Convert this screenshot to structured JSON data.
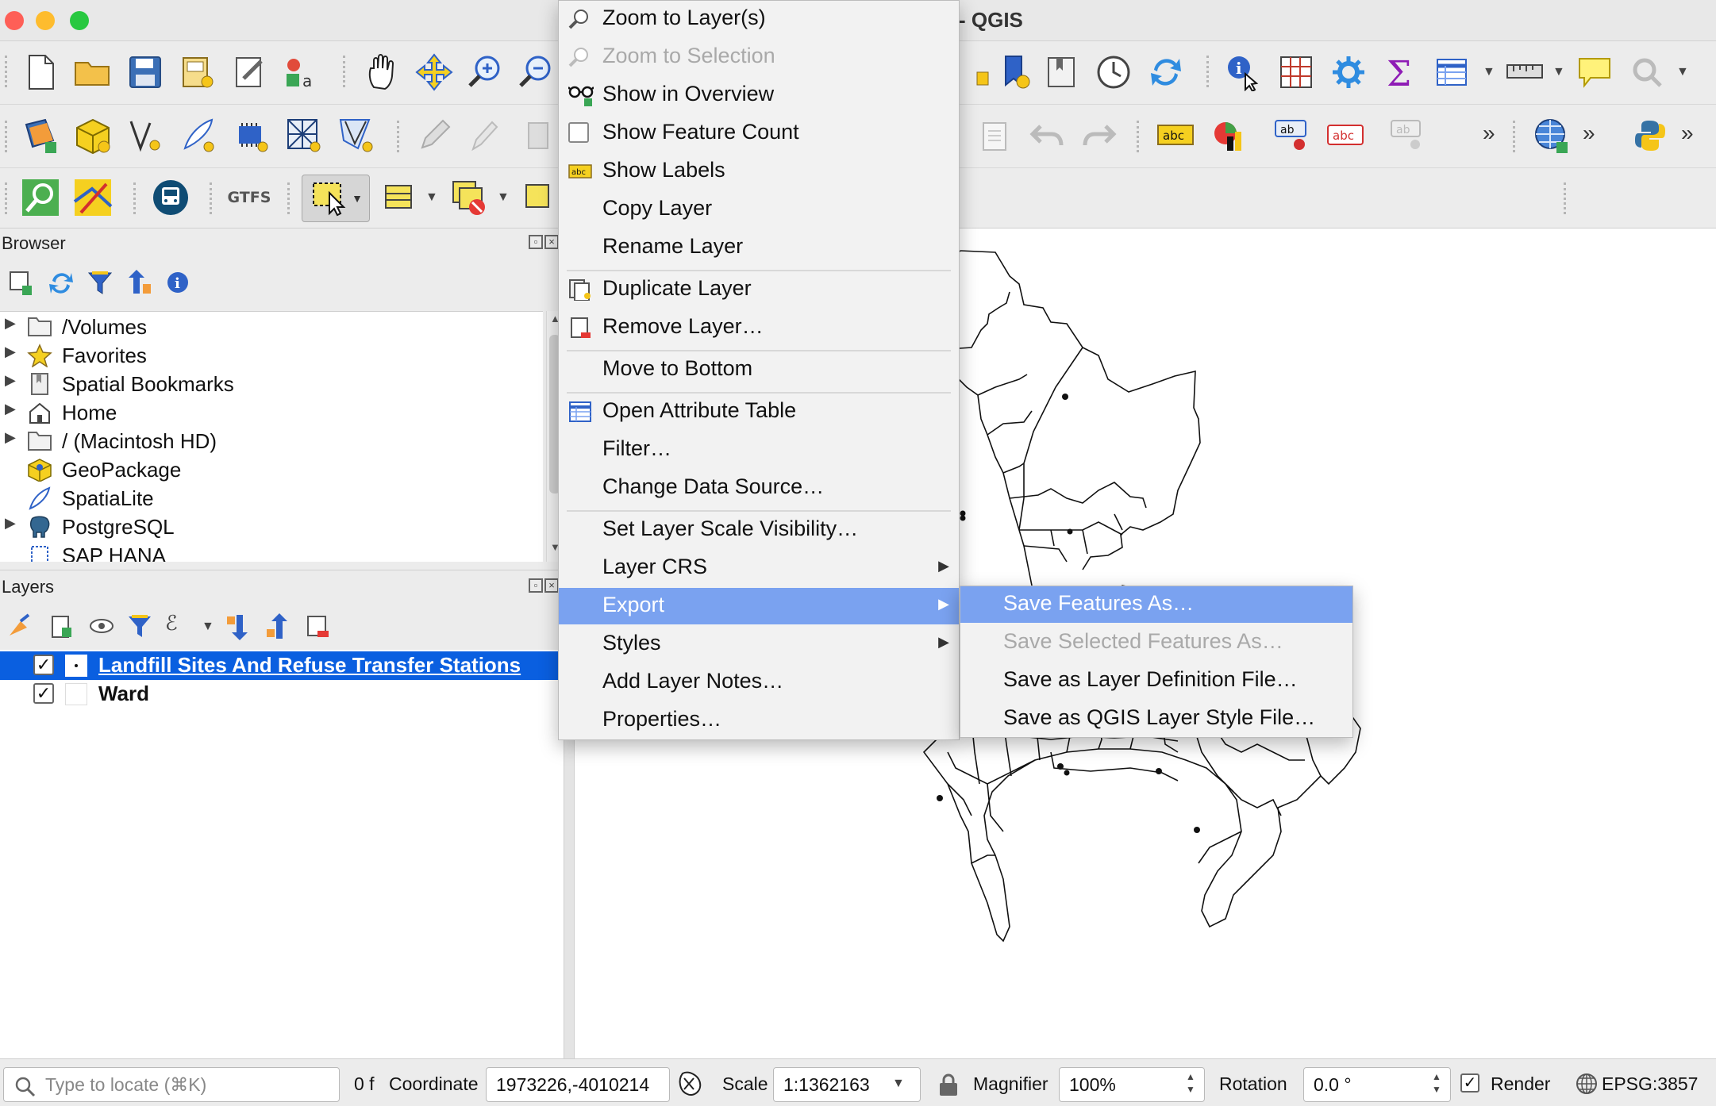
{
  "window": {
    "title": "- QGIS",
    "traffic_lights": {
      "close": "#fe5f57",
      "minimize": "#febc2e",
      "maximize": "#28c840"
    }
  },
  "toolbar_icons": {
    "row1": [
      "new-project-icon",
      "open-project-icon",
      "save-project-icon",
      "new-print-layout-icon",
      "layout-manager-icon",
      "style-manager-icon",
      "pan-map-icon",
      "pan-to-selection-icon",
      "zoom-in-icon",
      "zoom-out-icon",
      "new-bookmark-icon",
      "show-bookmarks-icon",
      "temporal-controller-icon",
      "refresh-icon",
      "identify-features-icon",
      "open-field-calculator-icon",
      "processing-toolbox-icon",
      "statistical-summary-icon",
      "open-attribute-table-icon",
      "measure-line-icon",
      "map-tips-icon",
      "more-tools-icon"
    ],
    "row2": [
      "data-source-manager-icon",
      "new-geopackage-layer-icon",
      "digitize-vertex-icon",
      "digitize-with-curve-icon",
      "new-temporary-layer-icon",
      "new-mesh-layer-icon",
      "vertex-tool-icon",
      "edit-pencil-icon",
      "toggle-editing-icon",
      "save-edits-icon",
      "paste-icon",
      "undo-icon",
      "redo-icon",
      "label-abc-icon",
      "diagram-icon",
      "pin-label-icon",
      "highlight-label-icon",
      "change-label-icon",
      "more-label-tools-icon",
      "add-wms-layer-icon",
      "python-console-icon"
    ],
    "row3": [
      "locator-search-icon",
      "quick-map-icon",
      "transit-icon",
      "gtfs-icon",
      "select-features-icon",
      "select-by-value-icon",
      "deselect-features-icon",
      "select-location-icon"
    ]
  },
  "gtfs_label": "GTFS",
  "browser": {
    "title": "Browser",
    "items": [
      {
        "label": "/Volumes",
        "icon": "folder-icon",
        "expandable": true
      },
      {
        "label": "Favorites",
        "icon": "star-icon",
        "expandable": true
      },
      {
        "label": "Spatial Bookmarks",
        "icon": "bookmark-icon",
        "expandable": true
      },
      {
        "label": "Home",
        "icon": "home-icon",
        "expandable": true
      },
      {
        "label": "/ (Macintosh HD)",
        "icon": "folder-icon",
        "expandable": true
      },
      {
        "label": "GeoPackage",
        "icon": "geopackage-icon",
        "expandable": false
      },
      {
        "label": "SpatiaLite",
        "icon": "spatialite-feather-icon",
        "expandable": false
      },
      {
        "label": "PostgreSQL",
        "icon": "postgresql-elephant-icon",
        "expandable": true
      },
      {
        "label": "SAP HANA",
        "icon": "sap-hana-icon",
        "expandable": false
      }
    ]
  },
  "layers": {
    "title": "Layers",
    "items": [
      {
        "label": "Landfill Sites And Refuse Transfer Stations",
        "checked": true,
        "selected": true
      },
      {
        "label": "Ward",
        "checked": true,
        "selected": false
      }
    ]
  },
  "context_menu": {
    "items": [
      {
        "label": "Zoom to Layer(s)",
        "icon": "zoom-layer-icon",
        "disabled": false
      },
      {
        "label": "Zoom to Selection",
        "icon": "zoom-selection-icon",
        "disabled": true
      },
      {
        "label": "Show in Overview",
        "icon": "overview-glasses-icon",
        "disabled": false
      },
      {
        "label": "Show Feature Count",
        "icon": "checkbox-icon",
        "disabled": false
      },
      {
        "label": "Show Labels",
        "icon": "labels-abc-icon",
        "disabled": false
      },
      {
        "label": "Copy Layer",
        "icon": "",
        "disabled": false
      },
      {
        "label": "Rename Layer",
        "icon": "",
        "disabled": false,
        "separator_after": true
      },
      {
        "label": "Duplicate Layer",
        "icon": "duplicate-layer-icon",
        "disabled": false
      },
      {
        "label": "Remove Layer…",
        "icon": "remove-layer-icon",
        "disabled": false,
        "separator_after": true
      },
      {
        "label": "Move to Bottom",
        "icon": "",
        "disabled": false,
        "separator_after": true
      },
      {
        "label": "Open Attribute Table",
        "icon": "attribute-table-icon",
        "disabled": false
      },
      {
        "label": "Filter…",
        "icon": "",
        "disabled": false
      },
      {
        "label": "Change Data Source…",
        "icon": "",
        "disabled": false,
        "separator_after": true
      },
      {
        "label": "Set Layer Scale Visibility…",
        "icon": "",
        "disabled": false
      },
      {
        "label": "Layer CRS",
        "icon": "",
        "disabled": false,
        "submenu": true
      },
      {
        "label": "Export",
        "icon": "",
        "disabled": false,
        "submenu": true,
        "highlighted": true
      },
      {
        "label": "Styles",
        "icon": "",
        "disabled": false,
        "submenu": true
      },
      {
        "label": "Add Layer Notes…",
        "icon": "",
        "disabled": false
      },
      {
        "label": "Properties…",
        "icon": "",
        "disabled": false
      }
    ]
  },
  "export_submenu": {
    "items": [
      {
        "label": "Save Features As…",
        "highlighted": true,
        "disabled": false
      },
      {
        "label": "Save Selected Features As…",
        "highlighted": false,
        "disabled": true
      },
      {
        "label": "Save as Layer Definition File…",
        "highlighted": false,
        "disabled": false
      },
      {
        "label": "Save as QGIS Layer Style File…",
        "highlighted": false,
        "disabled": false
      }
    ]
  },
  "statusbar": {
    "locator_placeholder": "Type to locate (⌘K)",
    "selected_count": "0 f",
    "coordinate_label": "Coordinate",
    "coordinate_value": "1973226,-4010214",
    "scale_label": "Scale",
    "scale_value": "1:1362163",
    "magnifier_label": "Magnifier",
    "magnifier_value": "100%",
    "rotation_label": "Rotation",
    "rotation_value": "0.0 °",
    "render_label": "Render",
    "render_checked": true,
    "crs_label": "EPSG:3857"
  },
  "colors": {
    "menu_highlight": "#7aa2f0",
    "layer_selection": "#0a5fe0",
    "panel_bg": "#ececec"
  }
}
